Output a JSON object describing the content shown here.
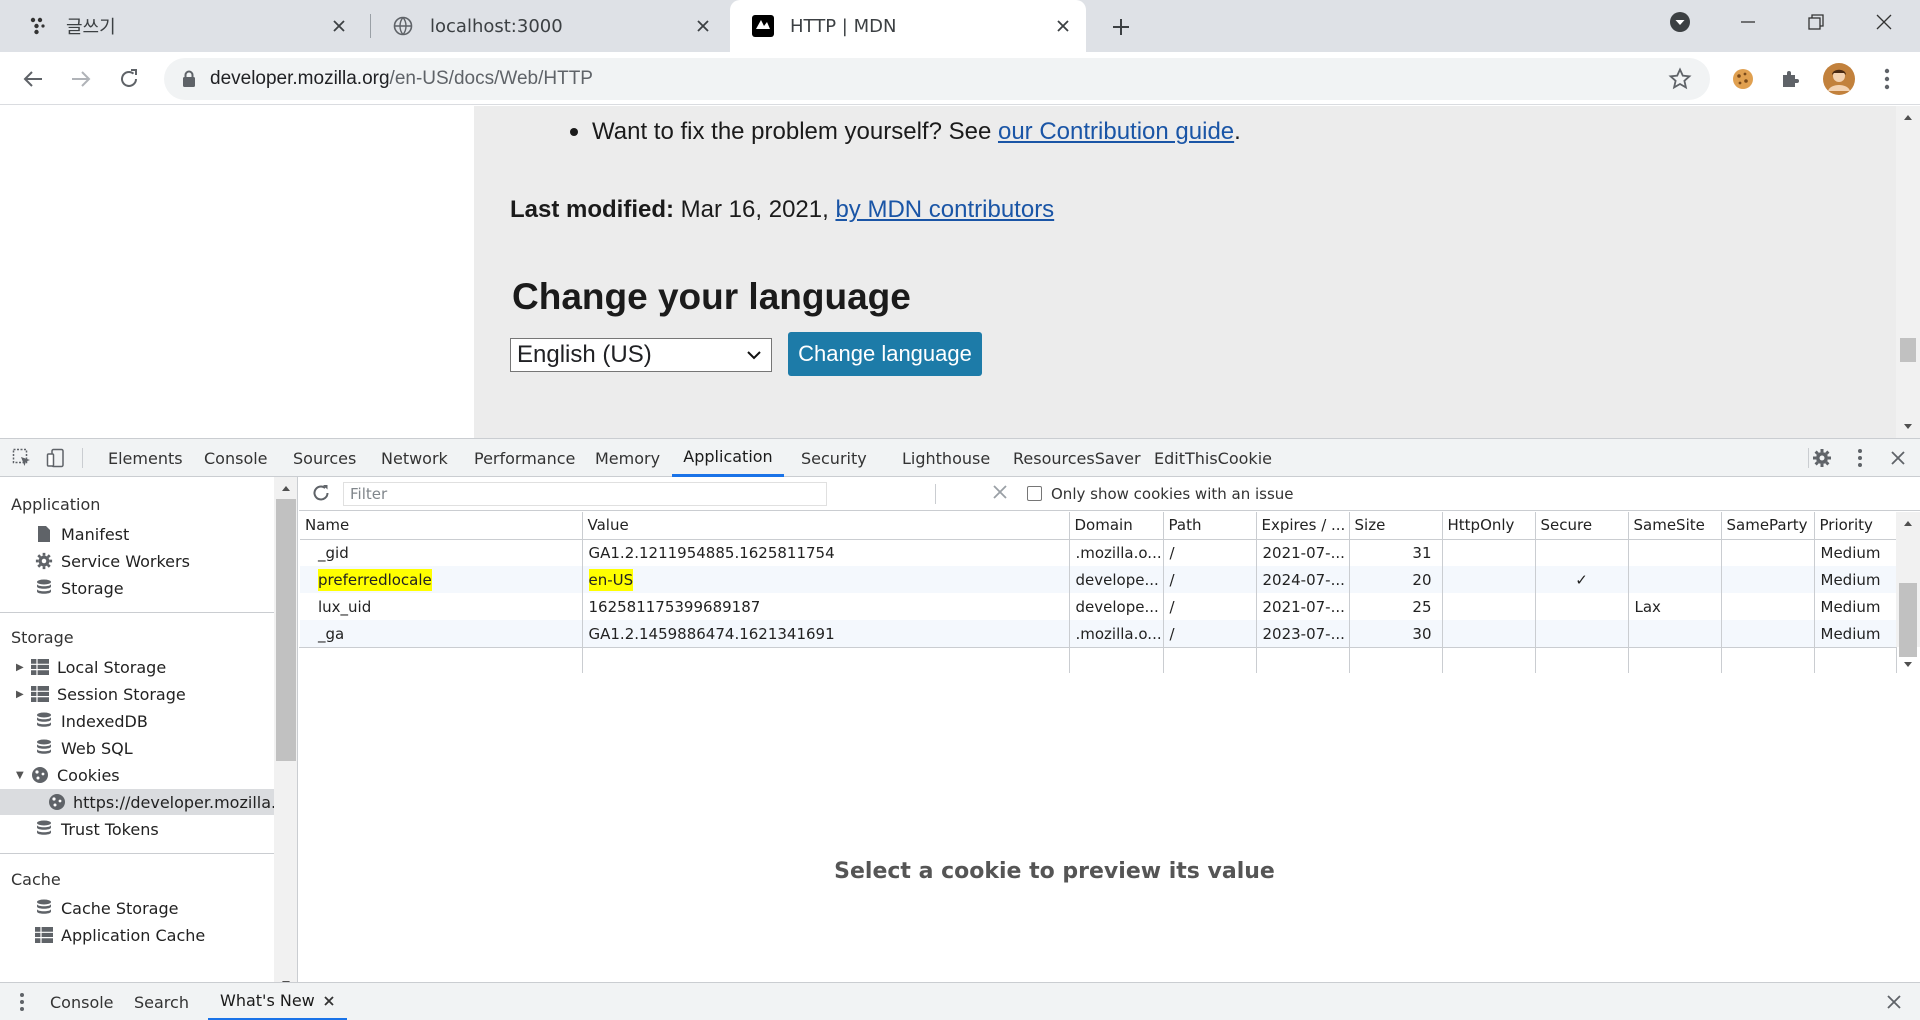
{
  "browser": {
    "tabs": [
      {
        "title": "글쓰기",
        "icon": "dots-favicon-icon"
      },
      {
        "title": "localhost:3000",
        "icon": "globe-icon"
      },
      {
        "title": "HTTP | MDN",
        "icon": "mdn-favicon-icon"
      }
    ],
    "url_domain": "developer.mozilla.org",
    "url_path": "/en-US/docs/Web/HTTP"
  },
  "page": {
    "bullet_text": "Want to fix the problem yourself? See ",
    "bullet_link": "our Contribution guide",
    "bullet_tail": ".",
    "last_modified_label": "Last modified:",
    "last_modified_date": " Mar 16, 2021, ",
    "last_modified_link": "by MDN contributors",
    "language_heading": "Change your language",
    "language_selected": "English (US)",
    "language_button": "Change language"
  },
  "devtools": {
    "tabs": [
      "Elements",
      "Console",
      "Sources",
      "Network",
      "Performance",
      "Memory",
      "Application",
      "Security",
      "Lighthouse",
      "ResourcesSaver",
      "EditThisCookie"
    ],
    "active_tab": "Application",
    "sidebar": {
      "application_header": "Application",
      "application_items": [
        "Manifest",
        "Service Workers",
        "Storage"
      ],
      "storage_header": "Storage",
      "storage_items": [
        "Local Storage",
        "Session Storage",
        "IndexedDB",
        "Web SQL",
        "Cookies"
      ],
      "cookie_origin": "https://developer.mozilla.org",
      "trust_tokens": "Trust Tokens",
      "cache_header": "Cache",
      "cache_items": [
        "Cache Storage",
        "Application Cache"
      ]
    },
    "cookies": {
      "filter_placeholder": "Filter",
      "only_issues_label": "Only show cookies with an issue",
      "columns": [
        "Name",
        "Value",
        "Domain",
        "Path",
        "Expires / ...",
        "Size",
        "HttpOnly",
        "Secure",
        "SameSite",
        "SameParty",
        "Priority"
      ],
      "rows": [
        {
          "name": "_gid",
          "value": "GA1.2.1211954885.1625811754",
          "domain": ".mozilla.o...",
          "path": "/",
          "expires": "2021-07-...",
          "size": "31",
          "httponly": "",
          "secure": "",
          "samesite": "",
          "sameparty": "",
          "priority": "Medium",
          "highlight": false
        },
        {
          "name": "preferredlocale",
          "value": "en-US",
          "domain": "develope...",
          "path": "/",
          "expires": "2024-07-...",
          "size": "20",
          "httponly": "",
          "secure": "✓",
          "samesite": "",
          "sameparty": "",
          "priority": "Medium",
          "highlight": true
        },
        {
          "name": "lux_uid",
          "value": "162581175399689187",
          "domain": "develope...",
          "path": "/",
          "expires": "2021-07-...",
          "size": "25",
          "httponly": "",
          "secure": "",
          "samesite": "Lax",
          "sameparty": "",
          "priority": "Medium",
          "highlight": false
        },
        {
          "name": "_ga",
          "value": "GA1.2.1459886474.1621341691",
          "domain": ".mozilla.o...",
          "path": "/",
          "expires": "2023-07-...",
          "size": "30",
          "httponly": "",
          "secure": "",
          "samesite": "",
          "sameparty": "",
          "priority": "Medium",
          "highlight": false
        }
      ],
      "highlight_color": "#ffff00",
      "preview_message": "Select a cookie to preview its value"
    },
    "drawer_tabs": [
      "Console",
      "Search",
      "What's New"
    ],
    "drawer_active": "What's New"
  },
  "colors": {
    "accent": "#1a73e8",
    "mdn_button": "#1d7ba8",
    "link": "#1a55a6"
  }
}
